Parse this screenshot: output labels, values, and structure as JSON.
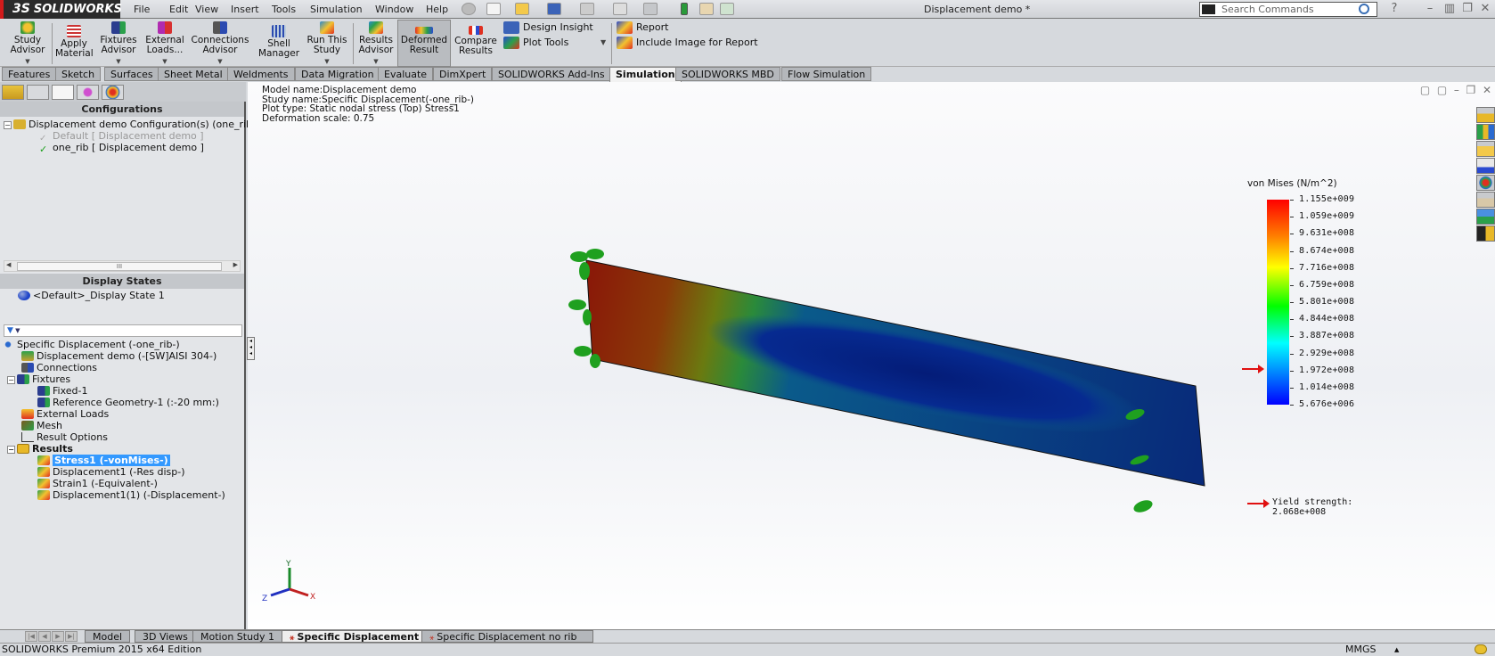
{
  "app": {
    "brand": "SOLIDWORKS",
    "brand_prefix": "3S",
    "document_title": "Displacement demo *",
    "menu": [
      "File",
      "Edit",
      "View",
      "Insert",
      "Tools",
      "Simulation",
      "Window",
      "Help"
    ],
    "search_placeholder": "Search Commands"
  },
  "command_manager": {
    "large_buttons": [
      {
        "id": "study-advisor",
        "label": "Study Advisor",
        "has_dropdown": true
      },
      {
        "id": "apply-material",
        "label": "Apply Material",
        "has_dropdown": false
      },
      {
        "id": "fixtures-advisor",
        "label": "Fixtures Advisor",
        "has_dropdown": true
      },
      {
        "id": "external-loads",
        "label": "External Loads...",
        "has_dropdown": true
      },
      {
        "id": "connections-advisor",
        "label": "Connections Advisor",
        "has_dropdown": true
      },
      {
        "id": "shell-manager",
        "label": "Shell Manager",
        "has_dropdown": false
      },
      {
        "id": "run-this-study",
        "label": "Run This Study",
        "has_dropdown": true
      },
      {
        "id": "results-advisor",
        "label": "Results Advisor",
        "has_dropdown": true
      },
      {
        "id": "deformed-result",
        "label": "Deformed Result",
        "has_dropdown": false,
        "active": true
      },
      {
        "id": "compare-results",
        "label": "Compare Results",
        "has_dropdown": false
      }
    ],
    "small_buttons": [
      {
        "id": "design-insight",
        "label": "Design Insight"
      },
      {
        "id": "plot-tools",
        "label": "Plot Tools"
      },
      {
        "id": "report",
        "label": "Report"
      },
      {
        "id": "include-image",
        "label": "Include Image for Report"
      }
    ]
  },
  "tabs": [
    "Features",
    "Sketch",
    "Surfaces",
    "Sheet Metal",
    "Weldments",
    "Data Migration",
    "Evaluate",
    "DimXpert",
    "SOLIDWORKS Add-Ins",
    "Simulation",
    "SOLIDWORKS MBD",
    "Flow Simulation"
  ],
  "active_tab": "Simulation",
  "left_panel": {
    "configurations": {
      "header": "Configurations",
      "root": "Displacement demo Configuration(s)  (one_rib)",
      "items": [
        {
          "label": "Default [ Displacement demo ]",
          "active": false
        },
        {
          "label": "one_rib [ Displacement demo ]",
          "active": true
        }
      ]
    },
    "display_states": {
      "header": "Display States",
      "items": [
        "<Default>_Display State 1"
      ]
    },
    "study_tree": {
      "root": "Specific Displacement (-one_rib-)",
      "items": [
        {
          "label": "Displacement demo (-[SW]AISI 304-)",
          "level": 1,
          "icon": "part-material-icon"
        },
        {
          "label": "Connections",
          "level": 1,
          "icon": "connections-icon"
        },
        {
          "label": "Fixtures",
          "level": 1,
          "icon": "fixtures-icon",
          "expanded": true
        },
        {
          "label": "Fixed-1",
          "level": 2,
          "icon": "fixture-icon"
        },
        {
          "label": "Reference Geometry-1 (:-20 mm:)",
          "level": 2,
          "icon": "fixture-icon"
        },
        {
          "label": "External Loads",
          "level": 1,
          "icon": "external-loads-icon"
        },
        {
          "label": "Mesh",
          "level": 1,
          "icon": "mesh-icon"
        },
        {
          "label": "Result Options",
          "level": 1,
          "icon": "result-options-icon"
        },
        {
          "label": "Results",
          "level": 1,
          "icon": "results-folder-icon",
          "expanded": true,
          "bold": true
        },
        {
          "label": "Stress1 (-vonMises-)",
          "level": 2,
          "icon": "stress-plot-icon",
          "selected": true
        },
        {
          "label": "Displacement1 (-Res disp-)",
          "level": 2,
          "icon": "displacement-plot-icon"
        },
        {
          "label": "Strain1 (-Equivalent-)",
          "level": 2,
          "icon": "strain-plot-icon"
        },
        {
          "label": "Displacement1(1) (-Displacement-)",
          "level": 2,
          "icon": "displacement-plot-icon"
        }
      ]
    }
  },
  "viewport": {
    "info_lines": [
      "Model name:Displacement demo",
      "Study name:Specific Displacement(-one_rib-)",
      "Plot type: Static nodal stress (Top) Stress1",
      "Deformation scale: 0.75"
    ],
    "legend": {
      "title": "von Mises (N/m^2)",
      "labels": [
        "1.155e+009",
        "1.059e+009",
        "9.631e+008",
        "8.674e+008",
        "7.716e+008",
        "6.759e+008",
        "5.801e+008",
        "4.844e+008",
        "3.887e+008",
        "2.929e+008",
        "1.972e+008",
        "1.014e+008",
        "5.676e+006"
      ],
      "yield_label": "Yield strength: 2.068e+008",
      "yield_value": 206800000,
      "max": 1155000000,
      "min": 5676000
    },
    "triad": {
      "x": "X",
      "y": "Y",
      "z": "Z"
    }
  },
  "bottom_tabs": [
    {
      "label": "Model",
      "active": false,
      "study": false
    },
    {
      "label": "3D Views",
      "active": false,
      "study": false
    },
    {
      "label": "Motion Study 1",
      "active": false,
      "study": false
    },
    {
      "label": "Specific Displacement",
      "active": true,
      "study": true
    },
    {
      "label": "Specific Displacement no rib",
      "active": false,
      "study": true
    }
  ],
  "status": {
    "edition": "SOLIDWORKS Premium 2015 x64 Edition",
    "units": "MMGS"
  }
}
